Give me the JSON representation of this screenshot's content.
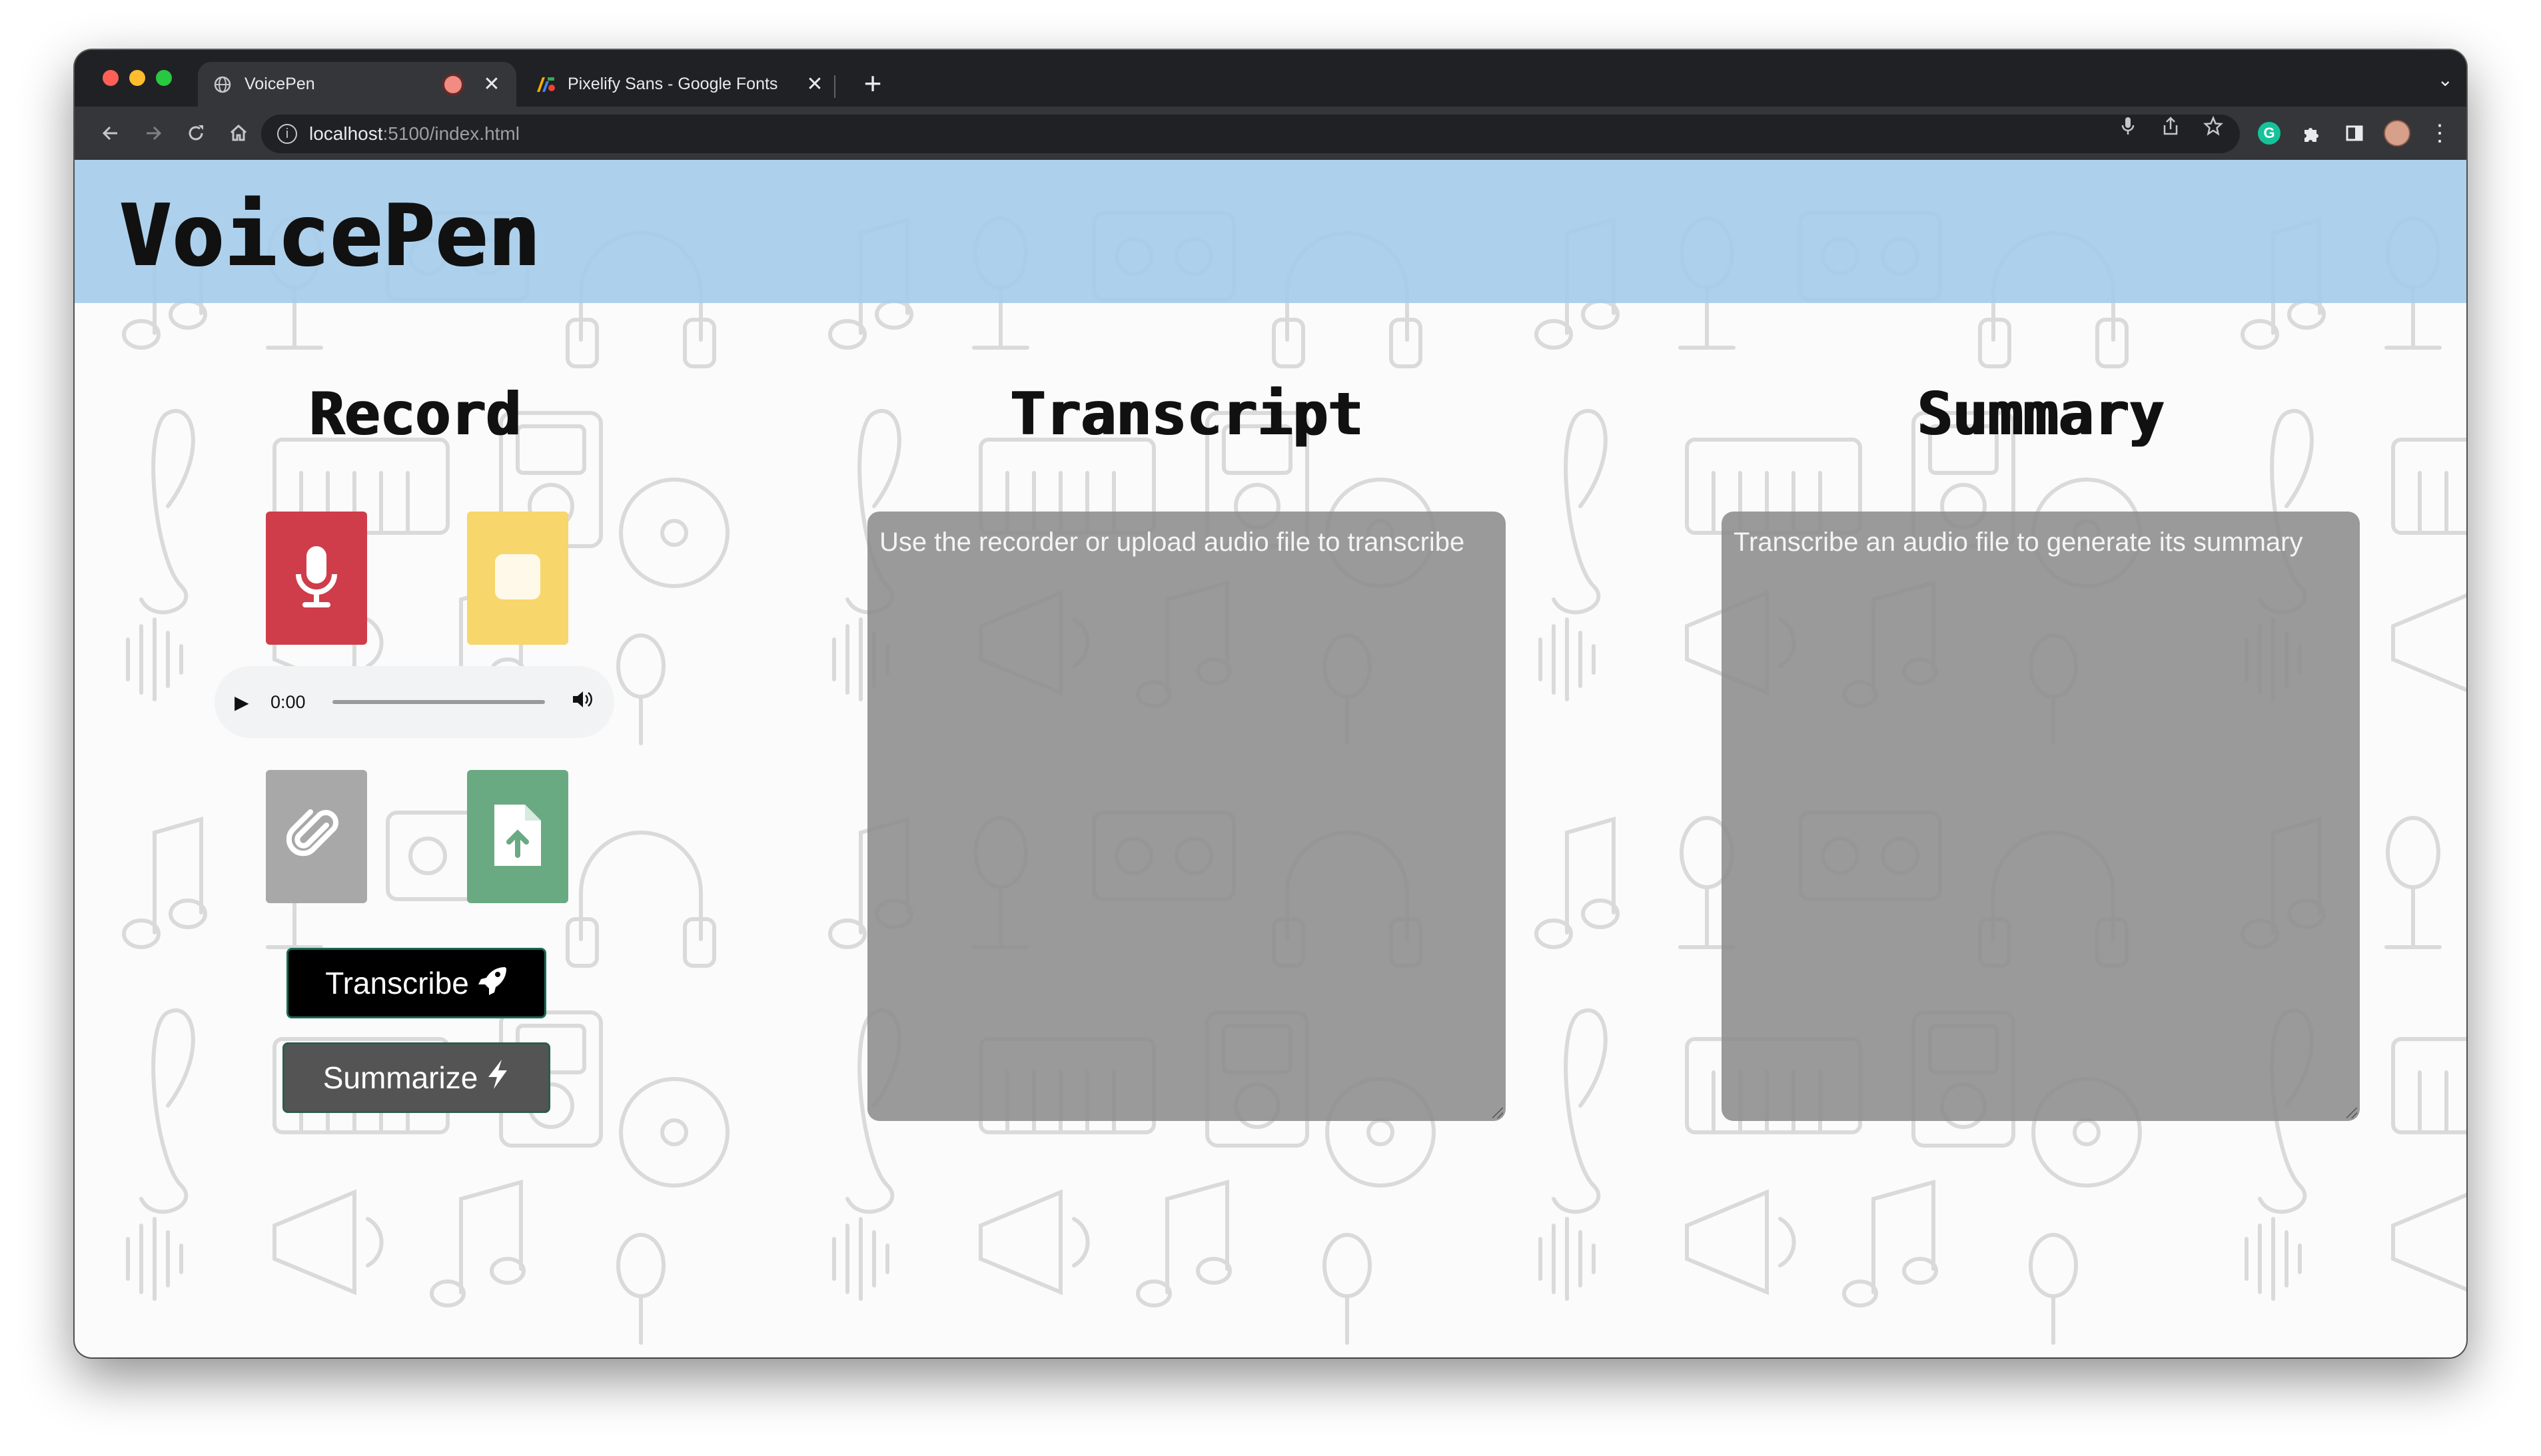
{
  "browser": {
    "tabs": [
      {
        "title": "VoicePen",
        "favicon": "globe-icon",
        "recording": true
      },
      {
        "title": "Pixelify Sans - Google Fonts",
        "favicon": "google-fonts-icon",
        "recording": false
      }
    ],
    "url": {
      "host": "localhost",
      "path": ":5100/index.html"
    },
    "toolbar_icons": [
      "mic-icon",
      "share-icon",
      "star-icon",
      "grammarly-icon",
      "extensions-icon",
      "side-panel-icon",
      "profile-avatar",
      "menu-icon"
    ]
  },
  "app": {
    "logo": "VoicePen",
    "record": {
      "title": "Record",
      "player_time": "0:00"
    },
    "transcript": {
      "title": "Transcript",
      "placeholder": "Use the recorder or upload audio file to transcribe"
    },
    "summary": {
      "title": "Summary",
      "placeholder": "Transcribe an audio file to generate its summary"
    },
    "buttons": {
      "transcribe": "Transcribe",
      "summarize": "Summarize"
    }
  },
  "colors": {
    "header_bg": "#a6cdeb",
    "mic_button": "#cf3d4a",
    "stop_button": "#f7d66b",
    "attach_button": "#a8a8a8",
    "upload_button": "#6aaa82",
    "transcribe_button": "#000000",
    "summarize_button": "#545454",
    "textbox_bg": "#8c8c8c"
  }
}
